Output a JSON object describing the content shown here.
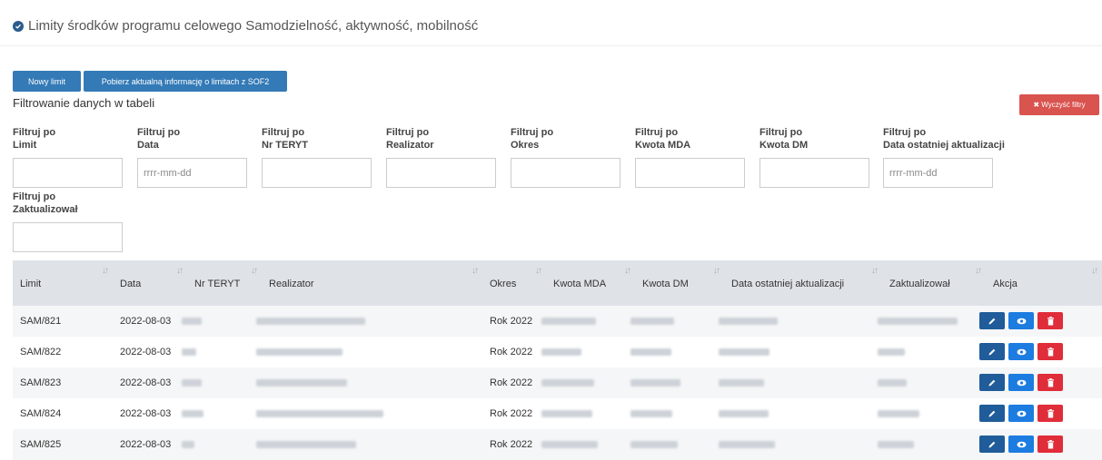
{
  "header": {
    "title": "Limity środków programu celowego Samodzielność, aktywność, mobilność"
  },
  "toolbar": {
    "new_limit": "Nowy limit",
    "fetch_info": "Pobierz aktualną informację o limitach z SOF2"
  },
  "filters": {
    "section_title": "Filtrowanie danych w tabeli",
    "clear_button": "✖ Wyczyść filtry",
    "prefix": "Filtruj po",
    "fields": [
      {
        "label": "Limit",
        "value": "",
        "placeholder": ""
      },
      {
        "label": "Data",
        "value": "",
        "placeholder": "rrrr-mm-dd"
      },
      {
        "label": "Nr TERYT",
        "value": "",
        "placeholder": ""
      },
      {
        "label": "Realizator",
        "value": "",
        "placeholder": ""
      },
      {
        "label": "Okres",
        "value": "",
        "placeholder": ""
      },
      {
        "label": "Kwota MDA",
        "value": "",
        "placeholder": ""
      },
      {
        "label": "Kwota DM",
        "value": "",
        "placeholder": ""
      },
      {
        "label": "Data ostatniej aktualizacji",
        "value": "",
        "placeholder": "rrrr-mm-dd"
      },
      {
        "label": "Zaktualizował",
        "value": "",
        "placeholder": ""
      }
    ]
  },
  "table": {
    "columns": [
      "Limit",
      "Data",
      "Nr TERYT",
      "Realizator",
      "Okres",
      "Kwota MDA",
      "Kwota DM",
      "Data ostatniej aktualizacji",
      "Zaktualizował",
      "Akcja"
    ],
    "rows": [
      {
        "limit": "SAM/821",
        "data": "2022-08-03",
        "okres": "Rok 2022"
      },
      {
        "limit": "SAM/822",
        "data": "2022-08-03",
        "okres": "Rok 2022"
      },
      {
        "limit": "SAM/823",
        "data": "2022-08-03",
        "okres": "Rok 2022"
      },
      {
        "limit": "SAM/824",
        "data": "2022-08-03",
        "okres": "Rok 2022"
      },
      {
        "limit": "SAM/825",
        "data": "2022-08-03",
        "okres": "Rok 2022"
      }
    ]
  },
  "icons": {
    "edit": "pencil-icon",
    "view": "eye-icon",
    "delete": "trash-icon",
    "sort": "sort-icon",
    "check": "check-circle-icon"
  },
  "colors": {
    "primary": "#337ab7",
    "danger": "#d9534f",
    "edit": "#1f5c99",
    "view": "#1c7ce0",
    "delete": "#e02d3a",
    "table_header": "#dfe3e8"
  }
}
